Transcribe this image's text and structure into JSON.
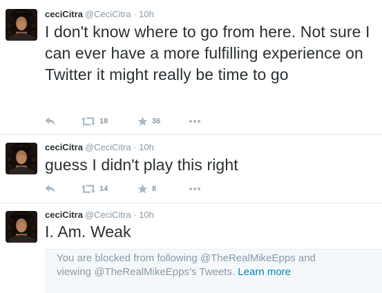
{
  "colors": {
    "text": "#292f33",
    "muted": "#8899a6",
    "link": "#0084b4",
    "divider": "#e1e8ed",
    "blocked_bg": "#f5f8fa"
  },
  "tweets": [
    {
      "name": "ceciCitra",
      "handle": "@CeciCitra",
      "separator": "·",
      "time": "10h",
      "text": "I don't know where to go from here. Not sure I can ever have a more fulfilling experience on Twitter it might really be time to go",
      "retweets": "18",
      "favorites": "36",
      "icons": [
        "reply-icon",
        "retweet-icon",
        "star-icon",
        "more-icon"
      ]
    },
    {
      "name": "ceciCitra",
      "handle": "@CeciCitra",
      "separator": "·",
      "time": "10h",
      "text": "guess I didn't play this right",
      "retweets": "14",
      "favorites": "8",
      "icons": [
        "reply-icon",
        "retweet-icon",
        "star-icon",
        "more-icon"
      ]
    },
    {
      "name": "ceciCitra",
      "handle": "@CeciCitra",
      "separator": "·",
      "time": "10h",
      "text": "I. Am. Weak"
    }
  ],
  "blocked_notice": {
    "line1": "You are blocked from following @TheRealMikeEpps and",
    "line2_prefix": "viewing @TheRealMikeEpps’s Tweets.",
    "learn_more": "Learn more"
  }
}
